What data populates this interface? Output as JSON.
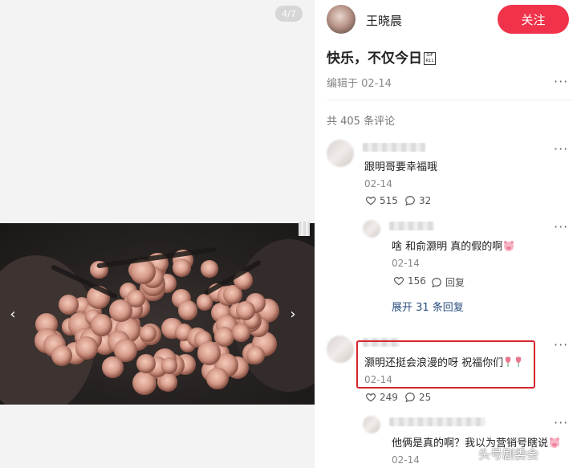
{
  "gallery": {
    "page_indicator": "4/7",
    "prev_icon": "chevron-left-icon",
    "next_icon": "chevron-right-icon"
  },
  "post": {
    "author": "王晓晨",
    "follow_label": "关注",
    "title": "快乐，不仅今日",
    "edit_date": "编辑于 02-14",
    "comment_count": "共 405 条评论"
  },
  "comments": [
    {
      "text": "跟明哥要幸福哦",
      "date": "02-14",
      "likes": "515",
      "replies_count": "32",
      "replies": [
        {
          "text": "啥 和俞灏明 真的假的啊",
          "date": "02-14",
          "likes": "156",
          "reply_label": "回复"
        }
      ],
      "expand_label": "展开 31 条回复"
    },
    {
      "text": "灏明还挺会浪漫的呀 祝福你们",
      "date": "02-14",
      "likes": "249",
      "replies_count": "25",
      "replies": [
        {
          "text": "他俩是真的啊？我以为营销号瞎说",
          "date": "02-14"
        }
      ]
    }
  ],
  "watermark": "头号剧委会",
  "colors": {
    "accent": "#f0334a",
    "link": "#2a4d7f",
    "highlight_border": "#d6262e"
  }
}
